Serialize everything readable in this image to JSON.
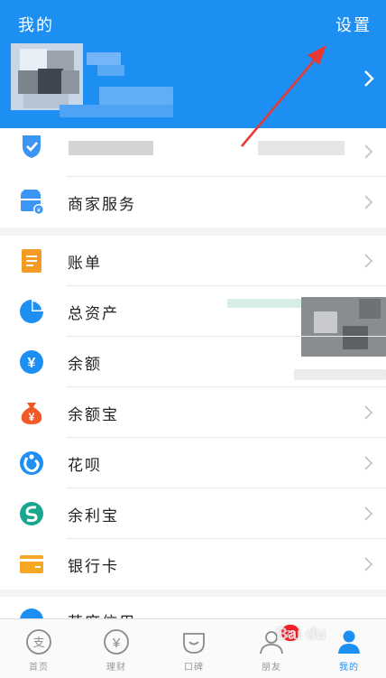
{
  "header": {
    "title": "我的",
    "settings_label": "设置",
    "background": "#1d8ff3"
  },
  "groups": [
    {
      "items": [
        {
          "label": "",
          "icon": "shield-icon"
        },
        {
          "label": "商家服务",
          "icon": "merchant-service-icon"
        }
      ]
    },
    {
      "items": [
        {
          "label": "账单",
          "icon": "bill-icon"
        },
        {
          "label": "总资产",
          "icon": "total-assets-icon"
        },
        {
          "label": "余额",
          "icon": "balance-yen-icon"
        },
        {
          "label": "余额宝",
          "icon": "money-bag-icon"
        },
        {
          "label": "花呗",
          "icon": "huabei-icon"
        },
        {
          "label": "余利宝",
          "icon": "yulibao-icon"
        },
        {
          "label": "银行卡",
          "icon": "bank-card-icon"
        }
      ]
    },
    {
      "items": [
        {
          "label": "芝麻信用",
          "icon": "sesame-credit-icon"
        }
      ]
    }
  ],
  "tabbar": {
    "tabs": [
      {
        "label": "首页",
        "icon": "alipay-home-icon"
      },
      {
        "label": "理财",
        "icon": "finance-yen-icon"
      },
      {
        "label": "口碑",
        "icon": "koubei-icon"
      },
      {
        "label": "朋友",
        "icon": "friends-icon",
        "badge": "78"
      },
      {
        "label": "我的",
        "icon": "me-icon",
        "active": true
      }
    ]
  },
  "watermark": "Bai du",
  "colors": {
    "accent": "#1d8ff3",
    "annotation_arrow": "#e53935",
    "badge": "#f5222d"
  }
}
